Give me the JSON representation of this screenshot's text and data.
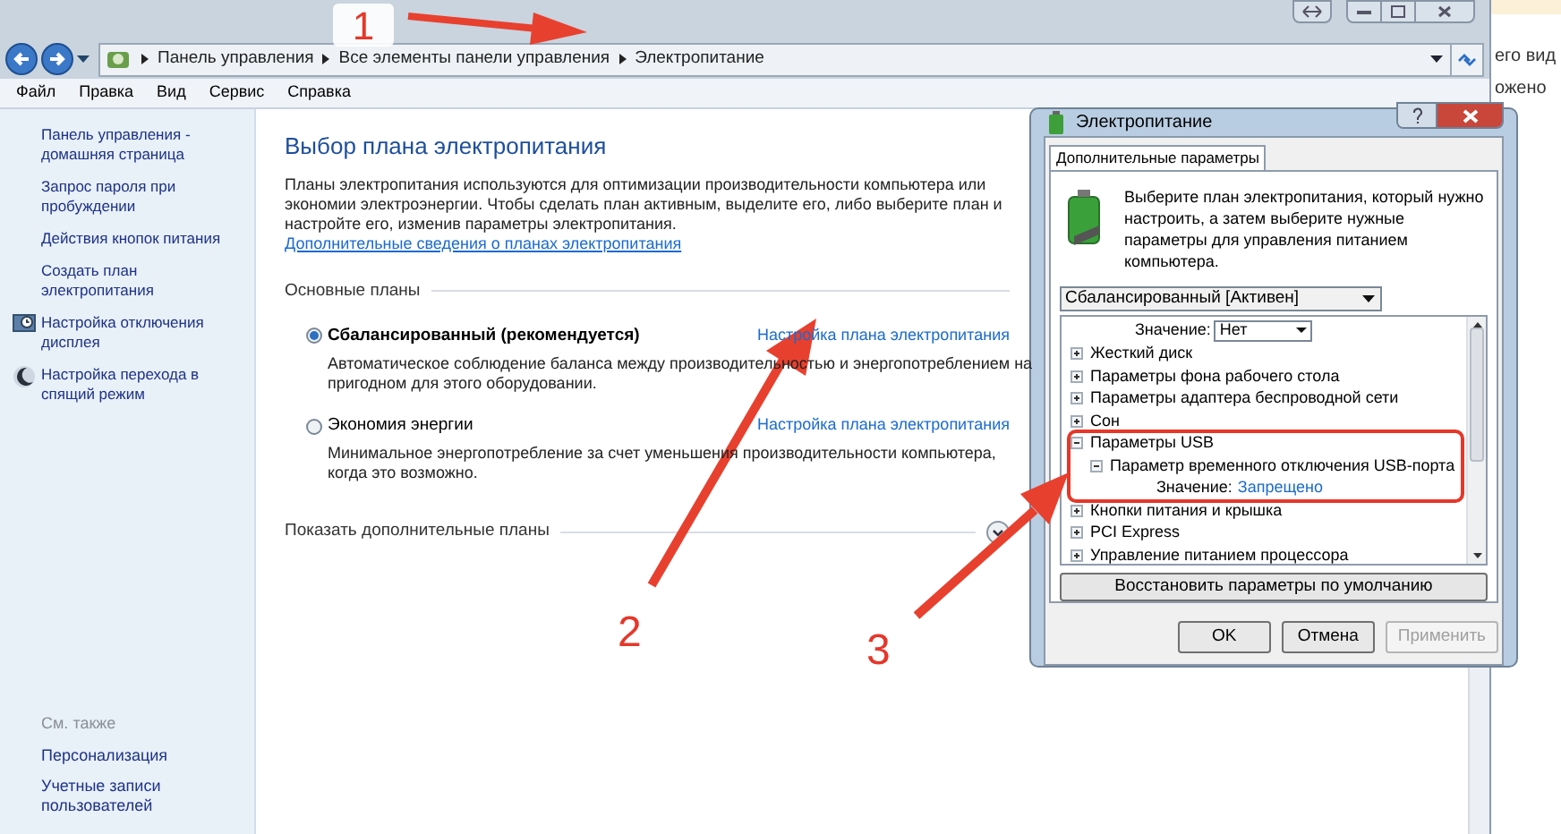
{
  "window": {
    "breadcrumb": [
      "Панель управления",
      "Все элементы панели управления",
      "Электропитание"
    ],
    "menu": [
      "Файл",
      "Правка",
      "Вид",
      "Сервис",
      "Справка"
    ]
  },
  "sidebar": {
    "items": [
      {
        "label": "Панель управления - домашняя страница",
        "kind": "link"
      },
      {
        "label": "Запрос пароля при пробуждении",
        "kind": "link"
      },
      {
        "label": "Действия кнопок питания",
        "kind": "link"
      },
      {
        "label": "Создать план электропитания",
        "kind": "link"
      },
      {
        "label": "Настройка отключения дисплея",
        "kind": "display-setting"
      },
      {
        "label": "Настройка перехода в спящий режим",
        "kind": "sleep-setting"
      }
    ],
    "see_also_heading": "См. также",
    "see_also": [
      "Персонализация",
      "Учетные записи пользователей"
    ]
  },
  "main": {
    "title": "Выбор плана электропитания",
    "intro": "Планы электропитания используются для оптимизации производительности компьютера или экономии электроэнергии. Чтобы сделать план активным, выделите его, либо выберите план и настройте его, изменив параметры электропитания.",
    "intro_link": "Дополнительные сведения о планах электропитания",
    "section": "Основные планы",
    "plans": [
      {
        "name": "Сбалансированный (рекомендуется)",
        "selected": true,
        "description": "Автоматическое соблюдение баланса между производительностью и энергопотреблением на пригодном для этого оборудовании.",
        "link": "Настройка плана электропитания"
      },
      {
        "name": "Экономия энергии",
        "selected": false,
        "description": "Минимальное энергопотребление за счет уменьшения производительности компьютера, когда это возможно.",
        "link": "Настройка плана электропитания"
      }
    ],
    "show_more": "Показать дополнительные планы"
  },
  "dialog": {
    "title": "Электропитание",
    "tab": "Дополнительные параметры",
    "description": "Выберите план электропитания, который нужно настроить, а затем выберите нужные параметры для управления питанием компьютера.",
    "plan_select": "Сбалансированный [Активен]",
    "tree": [
      {
        "kind": "select",
        "label": "Значение:",
        "value": "Нет"
      },
      {
        "kind": "group",
        "label": "Жесткий диск",
        "expanded": false,
        "highlighted": false
      },
      {
        "kind": "group",
        "label": "Параметры фона рабочего стола",
        "expanded": false,
        "highlighted": false
      },
      {
        "kind": "group",
        "label": "Параметры адаптера беспроводной сети",
        "expanded": false,
        "highlighted": false
      },
      {
        "kind": "group",
        "label": "Сон",
        "expanded": false,
        "highlighted": false
      },
      {
        "kind": "group",
        "label": "Параметры USB",
        "expanded": true,
        "highlighted": true,
        "children": [
          {
            "kind": "group",
            "label": "Параметр временного отключения USB-порта",
            "expanded": true,
            "children": [
              {
                "kind": "value",
                "label": "Значение:",
                "value": "Запрещено"
              }
            ]
          }
        ]
      },
      {
        "kind": "group",
        "label": "Кнопки питания и крышка",
        "expanded": false,
        "highlighted": false
      },
      {
        "kind": "group",
        "label": "PCI Express",
        "expanded": false,
        "highlighted": false
      },
      {
        "kind": "group",
        "label": "Управление питанием процессора",
        "expanded": false,
        "highlighted": false
      }
    ],
    "restore_button": "Восстановить параметры по умолчанию",
    "buttons": [
      {
        "label": "OK",
        "disabled": false
      },
      {
        "label": "Отмена",
        "disabled": false
      },
      {
        "label": "Применить",
        "disabled": true
      }
    ]
  },
  "background_page": [
    "его вид",
    "ожено"
  ],
  "annotations": [
    "1",
    "2",
    "3"
  ]
}
